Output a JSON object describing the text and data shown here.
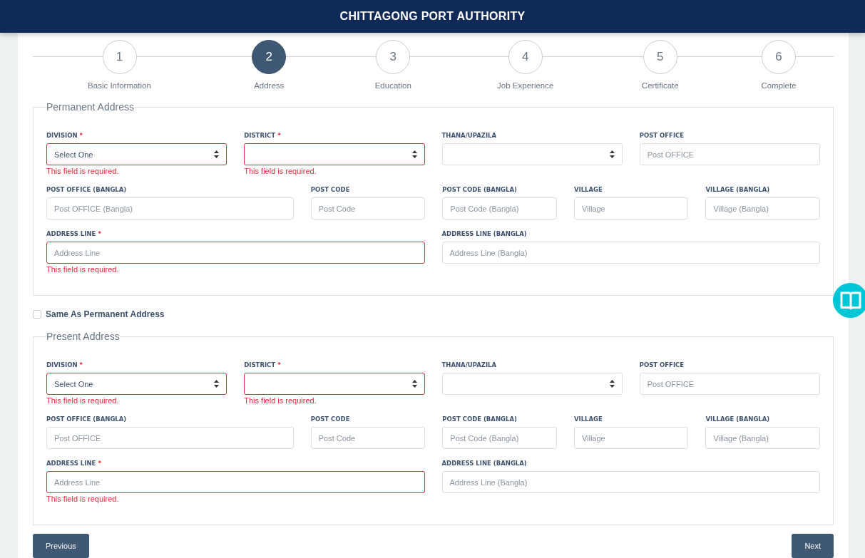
{
  "header": {
    "title": "CHITTAGONG PORT AUTHORITY"
  },
  "steps": [
    {
      "number": "1",
      "label": "Basic Information",
      "selected": false
    },
    {
      "number": "2",
      "label": "Address",
      "selected": true
    },
    {
      "number": "3",
      "label": "Education",
      "selected": false
    },
    {
      "number": "4",
      "label": "Job Experience",
      "selected": false
    },
    {
      "number": "5",
      "label": "Certificate",
      "selected": false
    },
    {
      "number": "6",
      "label": "Complete",
      "selected": false
    }
  ],
  "permanent_address": {
    "legend": "Permanent Address",
    "fields": [
      {
        "kind": "select",
        "label": "DIVISION",
        "mark": "*",
        "value": "Select One",
        "error": "This field is required."
      },
      {
        "kind": "select",
        "label": "DISTRICT",
        "mark": "*",
        "error": "This field is required."
      },
      {
        "kind": "select",
        "label": "THANA/UPAZILA"
      },
      {
        "kind": "text",
        "label": "POST OFFICE",
        "placeholder": "Post OFFICE"
      },
      {
        "kind": "text",
        "label": "POST OFFICE (BANGLA)",
        "placeholder": "Post OFFICE (Bangla)"
      },
      {
        "kind": "text",
        "label": "POST CODE",
        "placeholder": "Post Code"
      },
      {
        "kind": "text",
        "label": "POST CODE (BANGLA)",
        "placeholder": "Post Code (Bangla)"
      },
      {
        "kind": "text",
        "label": "VILLAGE",
        "placeholder": "Village"
      },
      {
        "kind": "text",
        "label": "VILLAGE (BANGLA)",
        "placeholder": "Village (Bangla)"
      },
      {
        "kind": "text",
        "label": "ADDRESS LINE",
        "mark": "*",
        "placeholder": "Address Line",
        "error": "This field is required."
      },
      {
        "kind": "text",
        "label": "ADDRESS LINE (BANGLA)",
        "placeholder": "Address Line (Bangla)"
      }
    ]
  },
  "same_as_permanent": {
    "label": "Same As Permanent Address",
    "checked": false
  },
  "present_address": {
    "legend": "Present Address",
    "fields": [
      {
        "kind": "select",
        "label": "DIVISION",
        "mark": "*",
        "value": "Select One",
        "error": "This field is required."
      },
      {
        "kind": "select",
        "label": "DISTRICT",
        "mark": "*",
        "error": "This field is required."
      },
      {
        "kind": "select",
        "label": "THANA/UPAZILA"
      },
      {
        "kind": "text",
        "label": "POST OFFICE",
        "placeholder": "Post OFFICE"
      },
      {
        "kind": "text",
        "label": "POST OFFICE (BANGLA)",
        "placeholder": "Post OFFICE"
      },
      {
        "kind": "text",
        "label": "POST CODE",
        "placeholder": "Post Code"
      },
      {
        "kind": "text",
        "label": "POST CODE (BANGLA)",
        "placeholder": "Post Code (Bangla)"
      },
      {
        "kind": "text",
        "label": "VILLAGE",
        "placeholder": "Village"
      },
      {
        "kind": "text",
        "label": "VILLAGE (BANGLA)",
        "placeholder": "Village (Bangla)"
      },
      {
        "kind": "text",
        "label": "ADDRESS LINE",
        "mark": "*",
        "placeholder": "Address Line",
        "error": "This field is required."
      },
      {
        "kind": "text",
        "label": "ADDRESS LINE (BANGLA)",
        "placeholder": "Address Line (Bangla)"
      }
    ]
  },
  "buttons": {
    "previous": "Previous",
    "next": "Next"
  }
}
